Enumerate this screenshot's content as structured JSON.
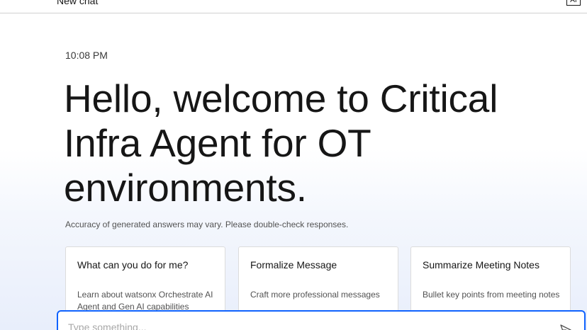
{
  "header": {
    "title": "New chat",
    "badge": "AI"
  },
  "main": {
    "timestamp": "10:08 PM",
    "welcome": "Hello, welcome to Critical Infra Agent for OT environments.",
    "disclaimer": "Accuracy of generated answers may vary. Please double-check responses."
  },
  "cards": [
    {
      "title": "What can you do for me?",
      "description": "Learn about watsonx Orchestrate AI Agent and Gen AI capabilities"
    },
    {
      "title": "Formalize Message",
      "description": "Craft more professional messages"
    },
    {
      "title": "Summarize Meeting Notes",
      "description": "Bullet key points from meeting notes"
    }
  ],
  "input": {
    "placeholder": "Type something...",
    "value": ""
  },
  "icons": {
    "send": "send-icon"
  },
  "colors": {
    "accent": "#0f62fe",
    "text": "#161616",
    "muted": "#525252"
  }
}
